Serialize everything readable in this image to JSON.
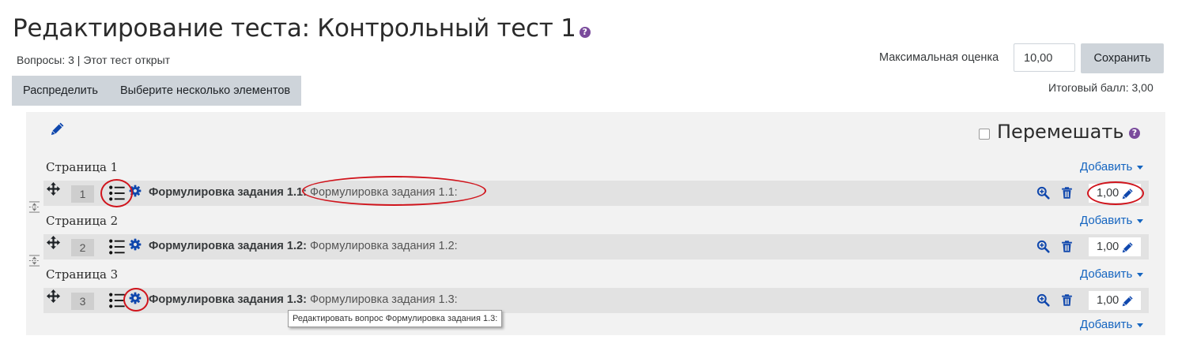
{
  "header": {
    "title": "Редактирование теста: Контрольный тест 1",
    "help_glyph": "?",
    "status": "Вопросы: 3 | Этот тест открыт"
  },
  "toolbar": {
    "repaginate_label": "Распределить",
    "select_multiple_label": "Выберите несколько элементов"
  },
  "grading": {
    "max_grade_label": "Максимальная оценка",
    "max_grade_value": "10,00",
    "save_label": "Сохранить",
    "total_label": "Итоговый балл: 3,00"
  },
  "section": {
    "shuffle_label": "Перемешать",
    "shuffle_checked": false
  },
  "add_label": "Добавить",
  "pages": [
    {
      "label": "Страница 1",
      "slot": {
        "number": "1",
        "name": "Формулировка задания 1.1:",
        "preview": "Формулировка задания 1.1:",
        "mark": "1,00"
      }
    },
    {
      "label": "Страница 2",
      "slot": {
        "number": "2",
        "name": "Формулировка задания 1.2:",
        "preview": "Формулировка задания 1.2:",
        "mark": "1,00"
      }
    },
    {
      "label": "Страница 3",
      "slot": {
        "number": "3",
        "name": "Формулировка задания 1.3:",
        "preview": "Формулировка задания 1.3:",
        "mark": "1,00"
      }
    }
  ],
  "tooltip": "Редактировать вопрос Формулировка задания 1.3:",
  "icons": {
    "move": "move-icon",
    "question_type": "list-icon",
    "edit_question": "gear-icon",
    "preview": "zoom-in-icon",
    "delete": "trash-icon",
    "edit_mark": "pencil-icon",
    "page_break": "page-break-icon",
    "help": "help-icon"
  },
  "colors": {
    "link": "#1565c0",
    "icon_dark_blue": "#0f47ad",
    "help_purple": "#7a4b9c",
    "annotation_red": "#d0141c",
    "button_gray": "#ced4da",
    "slot_gray": "#e2e2e2",
    "panel_gray": "#f2f2f2"
  }
}
